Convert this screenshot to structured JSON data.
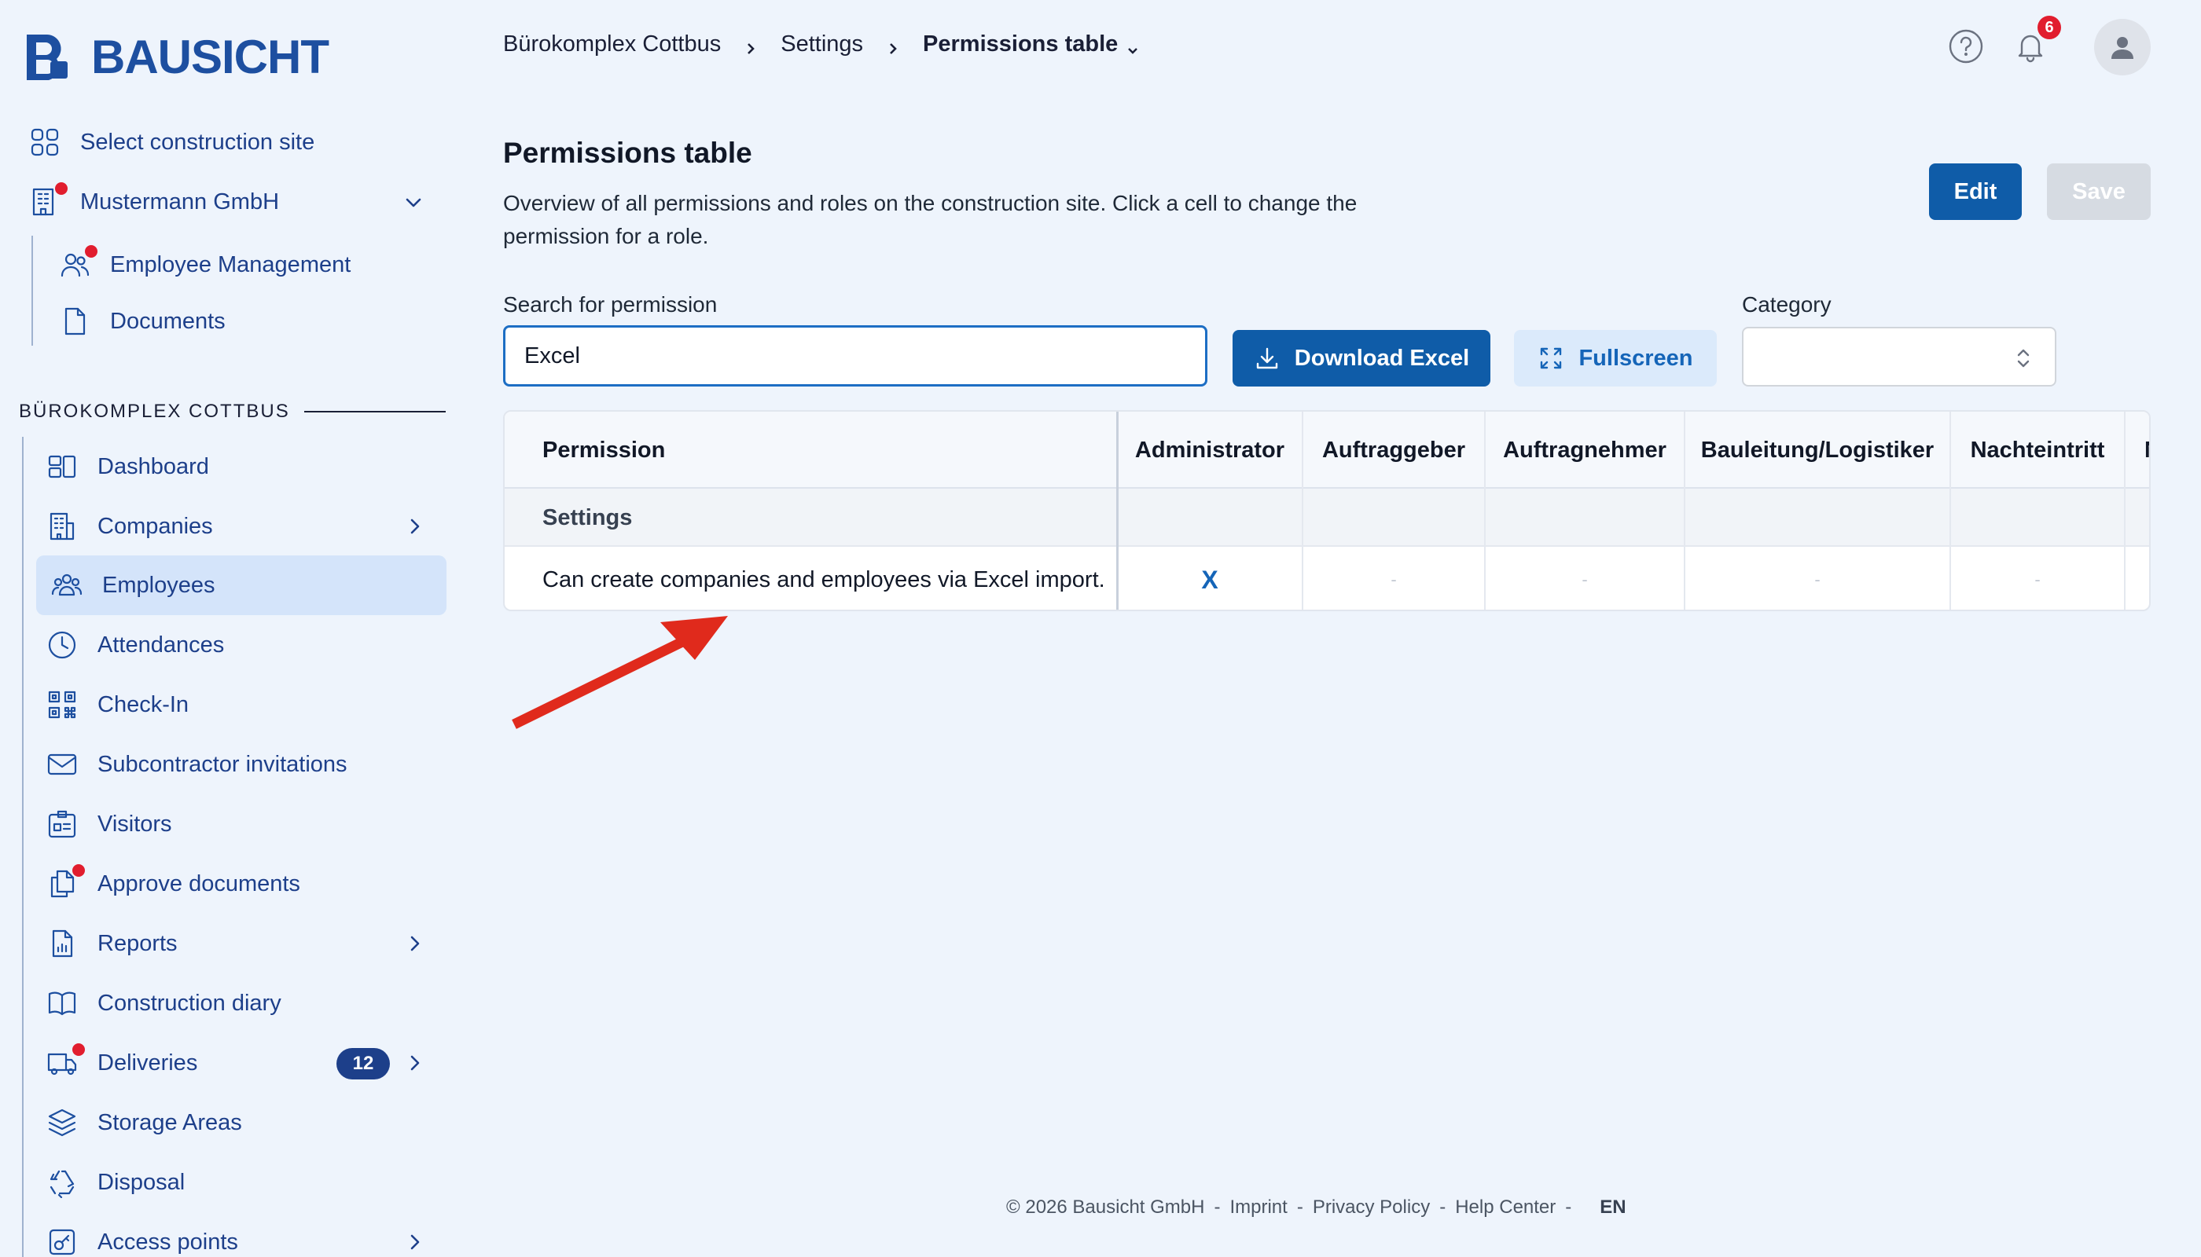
{
  "brand": {
    "name": "BAUSICHT",
    "color": "#1d4fa0"
  },
  "sidebar": {
    "select_site": "Select construction site",
    "company": "Mustermann GmbH",
    "company_sub": [
      {
        "label": "Employee Management",
        "icon": "users-icon"
      },
      {
        "label": "Documents",
        "icon": "document-icon"
      }
    ],
    "section_title": "BÜROKOMPLEX COTTBUS",
    "items": [
      {
        "label": "Dashboard",
        "icon": "dashboard-icon"
      },
      {
        "label": "Companies",
        "icon": "building-icon"
      },
      {
        "label": "Employees",
        "icon": "users-icon",
        "active": true
      },
      {
        "label": "Attendances",
        "icon": "clock-icon"
      },
      {
        "label": "Check-In",
        "icon": "qr-code-icon"
      },
      {
        "label": "Subcontractor invitations",
        "icon": "mail-icon"
      },
      {
        "label": "Visitors",
        "icon": "id-badge-icon"
      },
      {
        "label": "Approve documents",
        "icon": "documents-icon"
      },
      {
        "label": "Reports",
        "icon": "report-icon"
      },
      {
        "label": "Construction diary",
        "icon": "book-icon"
      },
      {
        "label": "Deliveries",
        "icon": "truck-icon",
        "badge": "12"
      },
      {
        "label": "Storage Areas",
        "icon": "layers-icon"
      },
      {
        "label": "Disposal",
        "icon": "recycle-icon"
      },
      {
        "label": "Access points",
        "icon": "key-icon"
      }
    ]
  },
  "header": {
    "breadcrumb": [
      "Bürokomplex Cottbus",
      "Settings",
      "Permissions table"
    ],
    "notification_count": "6"
  },
  "main": {
    "title": "Permissions table",
    "description": "Overview of all permissions and roles on the construction site. Click a cell to change the permission for a role.",
    "edit_label": "Edit",
    "save_label": "Save",
    "search_label": "Search for permission",
    "search_value": "Excel",
    "download_label": "Download Excel",
    "fullscreen_label": "Fullscreen",
    "category_label": "Category",
    "category_value": ""
  },
  "table": {
    "columns": [
      "Permission",
      "Administrator",
      "Auftraggeber",
      "Auftragnehmer",
      "Bauleitung/Logistiker",
      "Nachteintritt",
      "N"
    ],
    "section": "Settings",
    "row": {
      "permission": "Can create companies and employees via Excel import.",
      "values": [
        "X",
        "-",
        "-",
        "-",
        "-"
      ]
    }
  },
  "footer": {
    "copyright": "© 2026 Bausicht GmbH",
    "links": [
      "Imprint",
      "Privacy Policy",
      "Help Center"
    ],
    "language": "EN"
  },
  "colors": {
    "primary": "#0f5ca8",
    "accent_red": "#e11d2e",
    "arrow": "#e02a1c"
  }
}
